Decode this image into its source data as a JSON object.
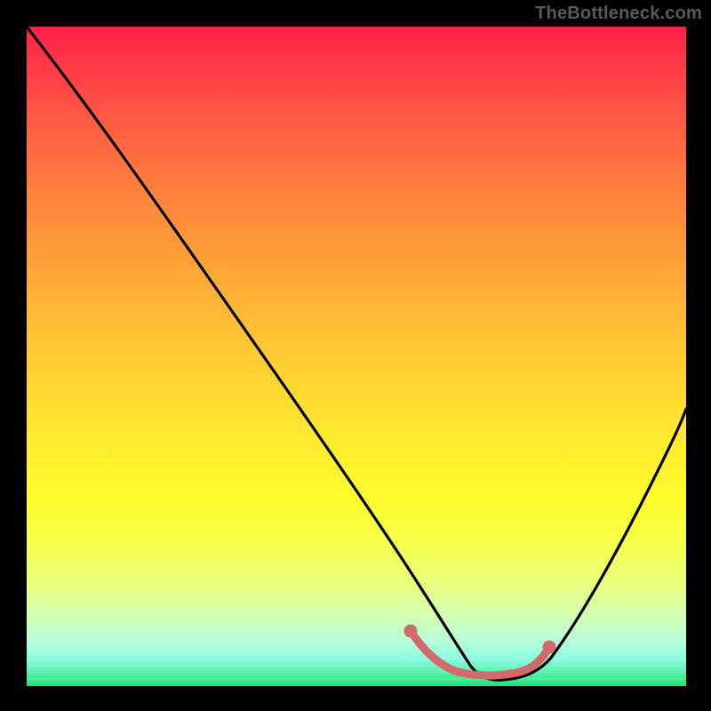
{
  "watermark": "TheBottleneck.com",
  "chart_data": {
    "type": "line",
    "title": "",
    "xlabel": "",
    "ylabel": "",
    "xlim": [
      0,
      100
    ],
    "ylim": [
      0,
      100
    ],
    "grid": false,
    "legend": false,
    "series": [
      {
        "name": "bottleneck-curve",
        "x": [
          0,
          5,
          10,
          15,
          20,
          25,
          30,
          35,
          40,
          45,
          50,
          55,
          58,
          62,
          66,
          70,
          74,
          78,
          80,
          84,
          88,
          92,
          96,
          100
        ],
        "y": [
          100,
          92,
          84,
          76,
          68,
          60,
          52,
          44,
          36,
          28,
          20,
          12,
          6,
          2,
          0.5,
          0.5,
          1,
          3,
          5,
          10,
          17,
          25,
          33,
          40
        ],
        "color": "#000000"
      },
      {
        "name": "optimal-range",
        "x": [
          58,
          60,
          63,
          66,
          69,
          72,
          75,
          77,
          78.5
        ],
        "y": [
          8,
          5.5,
          3.5,
          3,
          3,
          3.3,
          4,
          5.2,
          6
        ],
        "color": "#d16a6a",
        "style": "thick"
      }
    ],
    "markers": [
      {
        "name": "optimal-start",
        "x": 58,
        "y": 8,
        "color": "#d16a6a"
      },
      {
        "name": "optimal-end",
        "x": 78.5,
        "y": 6,
        "color": "#d16a6a"
      }
    ]
  },
  "gradient_stops": [
    {
      "pos": 0,
      "color": "#ff1f4a"
    },
    {
      "pos": 50,
      "color": "#ffd332"
    },
    {
      "pos": 100,
      "color": "#20e374"
    }
  ]
}
